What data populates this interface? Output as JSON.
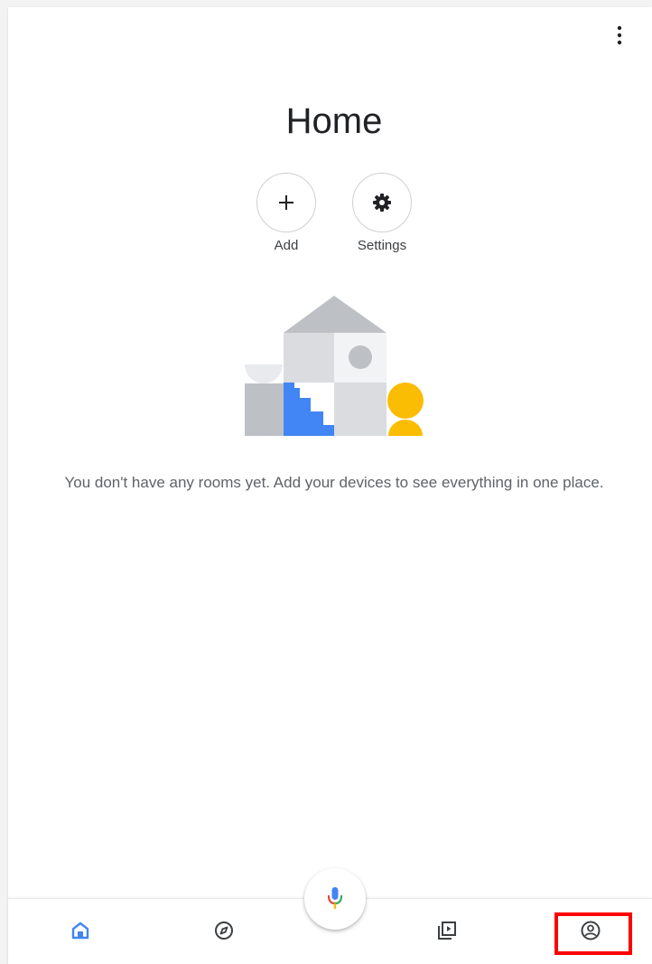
{
  "page": {
    "title": "Home"
  },
  "actions": [
    {
      "label": "Add",
      "icon": "plus-icon"
    },
    {
      "label": "Settings",
      "icon": "gear-icon"
    }
  ],
  "empty_state": {
    "message": "You don't have any rooms yet. Add your devices to see everything in one place.",
    "illustration": "house-illustration"
  },
  "toolbar": {
    "overflow_icon": "more-vert-icon"
  },
  "bottom_nav": {
    "items": [
      {
        "id": "home",
        "icon": "home-icon",
        "active": true
      },
      {
        "id": "discover",
        "icon": "compass-icon",
        "active": false
      },
      {
        "id": "media",
        "icon": "media-icon",
        "active": false
      },
      {
        "id": "account",
        "icon": "account-icon",
        "active": false
      }
    ],
    "fab_icon": "microphone-icon"
  },
  "colors": {
    "accent_blue": "#4285F4",
    "google_red": "#EA4335",
    "google_yellow": "#FBBC04",
    "google_green": "#34A853",
    "text_primary": "#202124",
    "text_secondary": "#5F6368",
    "highlight": "#FF0000"
  }
}
